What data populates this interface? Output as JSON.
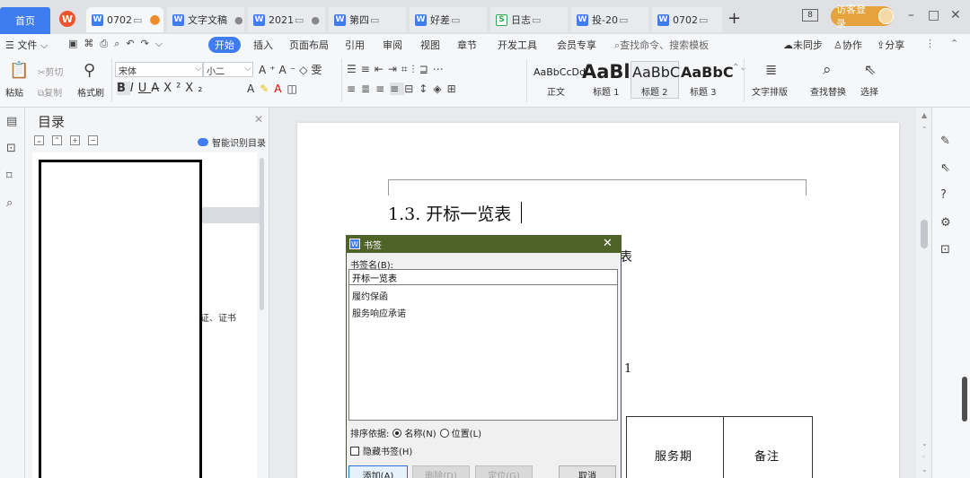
{
  "tabs": {
    "home": "首页",
    "items": [
      {
        "label": "0702",
        "icon": "W",
        "status": "unsaved"
      },
      {
        "label": "文字文稿",
        "icon": "W"
      },
      {
        "label": "2021",
        "icon": "W"
      },
      {
        "label": "第四",
        "icon": "W"
      },
      {
        "label": "好差",
        "icon": "W"
      },
      {
        "label": "日志",
        "icon": "S"
      },
      {
        "label": "投-20",
        "icon": "W"
      },
      {
        "label": "0702",
        "icon": "W"
      }
    ],
    "new_tab": "+",
    "window_count": "8",
    "login": "访客登录"
  },
  "menu": {
    "items": [
      "文件",
      "开始",
      "插入",
      "页面布局",
      "引用",
      "审阅",
      "视图",
      "章节",
      "开发工具",
      "会员专享"
    ],
    "search_placeholder": "查找命令、搜索模板",
    "sync": "未同步",
    "collab": "协作",
    "share": "分享"
  },
  "ribbon": {
    "paste": "粘贴",
    "cut": "剪切",
    "copy": "复制",
    "format_painter": "格式刷",
    "font_name": "宋体",
    "font_size": "小二",
    "styles": [
      {
        "sample": "AaBbCcDd",
        "name": "正文"
      },
      {
        "sample": "AaBl",
        "name": "标题 1"
      },
      {
        "sample": "AaBbC",
        "name": "标题 2"
      },
      {
        "sample": "AaBbC",
        "name": "标题 3"
      }
    ],
    "text_layout": "文字排版",
    "find_replace": "查找替换",
    "select": "选择"
  },
  "toc": {
    "title": "目录",
    "smart": "智能识别目录",
    "visible_entry_text": "证、证书"
  },
  "document": {
    "heading": "1.3. 开标一览表",
    "fragment_biao": "表",
    "fragment_one": "1",
    "table_cells": [
      "服务期",
      "备注"
    ]
  },
  "dialog": {
    "title": "书签",
    "name_label": "书签名(B):",
    "name_value": "开标一览表",
    "items": [
      "履约保函",
      "服务响应承诺"
    ],
    "sort_label": "排序依据:",
    "sort_by_name": "名称(N)",
    "sort_by_position": "位置(L)",
    "hide_bookmarks": "隐藏书签(H)",
    "buttons": [
      "添加(A)",
      "删除(D)",
      "定位(G)",
      "取消"
    ]
  }
}
